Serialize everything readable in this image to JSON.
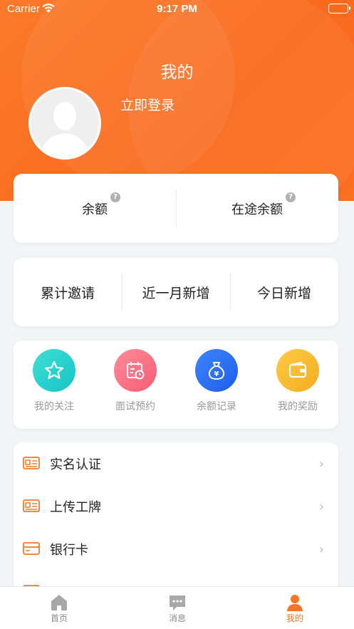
{
  "status_bar": {
    "carrier": "Carrier",
    "time": "9:17 PM"
  },
  "header": {
    "title": "我的",
    "login_label": "立即登录"
  },
  "balance": [
    {
      "label": "余额",
      "help": "?"
    },
    {
      "label": "在途余额",
      "help": "?"
    }
  ],
  "invite_stats": [
    {
      "label": "累计邀请"
    },
    {
      "label": "近一月新增"
    },
    {
      "label": "今日新增"
    }
  ],
  "shortcuts": [
    {
      "label": "我的关注",
      "icon": "star-icon",
      "color": "#1fcfc6"
    },
    {
      "label": "面试预约",
      "icon": "calendar-icon",
      "color": "#fb6f82"
    },
    {
      "label": "余额记录",
      "icon": "money-bag-icon",
      "color": "#2c6df5"
    },
    {
      "label": "我的奖励",
      "icon": "wallet-icon",
      "color": "#f7bb2e"
    }
  ],
  "menu": [
    {
      "label": "实名认证",
      "icon": "id-card-icon"
    },
    {
      "label": "上传工牌",
      "icon": "badge-card-icon"
    },
    {
      "label": "银行卡",
      "icon": "bank-card-icon"
    }
  ],
  "tabs": [
    {
      "label": "首页",
      "icon": "home-icon",
      "active": false
    },
    {
      "label": "消息",
      "icon": "message-icon",
      "active": false
    },
    {
      "label": "我的",
      "icon": "person-icon",
      "active": true
    }
  ],
  "colors": {
    "accent": "#f97424",
    "header_bg": "#fb7a2a"
  }
}
